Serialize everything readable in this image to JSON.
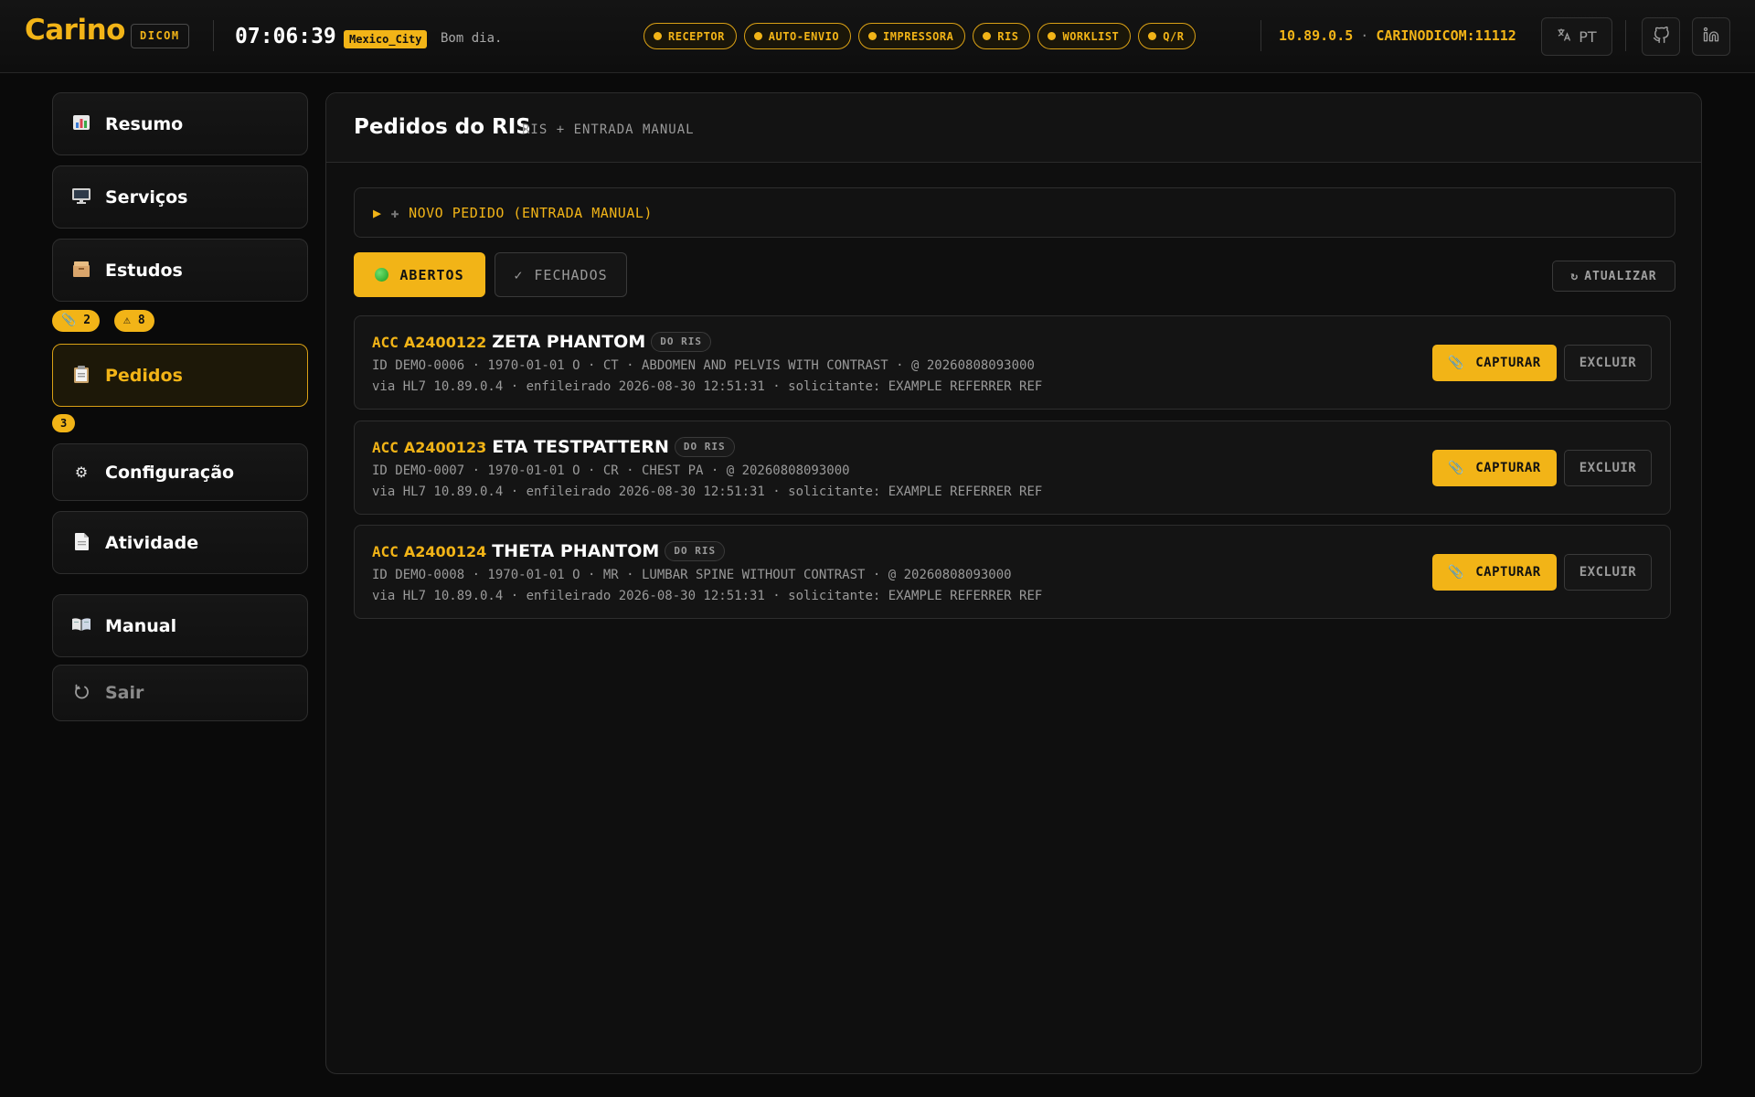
{
  "header": {
    "logo": "Carino",
    "logo_tag": "DICOM",
    "clock": "07:06:39",
    "timezone": "Mexico_City",
    "greeting": "Bom dia.",
    "services": [
      "RECEPTOR",
      "AUTO-ENVIO",
      "IMPRESSORA",
      "RIS",
      "WORKLIST",
      "Q/R"
    ],
    "host_ip": "10.89.0.5",
    "host_sep": "·",
    "host_ae": "CARINODICOM:11112",
    "language": "PT",
    "accent_color": "#f2b417"
  },
  "sidebar": {
    "items": [
      {
        "label": "Resumo",
        "icon": "bar-chart-icon"
      },
      {
        "label": "Serviços",
        "icon": "monitor-icon"
      },
      {
        "label": "Estudos",
        "icon": "box-icon"
      },
      {
        "label": "Pedidos",
        "icon": "clipboard-icon"
      },
      {
        "label": "Configuração",
        "icon": "gear-icon"
      },
      {
        "label": "Atividade",
        "icon": "document-icon"
      },
      {
        "label": "Manual",
        "icon": "book-icon"
      },
      {
        "label": "Sair",
        "icon": "power-icon"
      }
    ],
    "estudos_badges": {
      "tagged": "2",
      "warnings": "8"
    },
    "pedidos_badge": "3"
  },
  "main": {
    "title": "Pedidos do RIS",
    "subtitle": "RIS + ENTRADA MANUAL",
    "new_order_label": "NOVO PEDIDO (ENTRADA MANUAL)",
    "tabs": {
      "open": "ABERTOS",
      "closed": "FECHADOS"
    },
    "refresh_label": "ATUALIZAR",
    "capture_label": "CAPTURAR",
    "delete_label": "EXCLUIR",
    "acc_prefix": "ACC",
    "orders": [
      {
        "accession": "A2400122",
        "patient": "ZETA PHANTOM",
        "source": "DO RIS",
        "details": "ID DEMO-0006 · 1970-01-01 O · CT · ABDOMEN AND PELVIS WITH CONTRAST · @ 20260808093000",
        "meta": "via HL7 10.89.0.4 · enfileirado 2026-08-30 12:51:31 · solicitante: EXAMPLE REFERRER REF"
      },
      {
        "accession": "A2400123",
        "patient": "ETA TESTPATTERN",
        "source": "DO RIS",
        "details": "ID DEMO-0007 · 1970-01-01 O · CR · CHEST PA · @ 20260808093000",
        "meta": "via HL7 10.89.0.4 · enfileirado 2026-08-30 12:51:31 · solicitante: EXAMPLE REFERRER REF"
      },
      {
        "accession": "A2400124",
        "patient": "THETA PHANTOM",
        "source": "DO RIS",
        "details": "ID DEMO-0008 · 1970-01-01 O · MR · LUMBAR SPINE WITHOUT CONTRAST · @ 20260808093000",
        "meta": "via HL7 10.89.0.4 · enfileirado 2026-08-30 12:51:31 · solicitante: EXAMPLE REFERRER REF"
      }
    ]
  }
}
